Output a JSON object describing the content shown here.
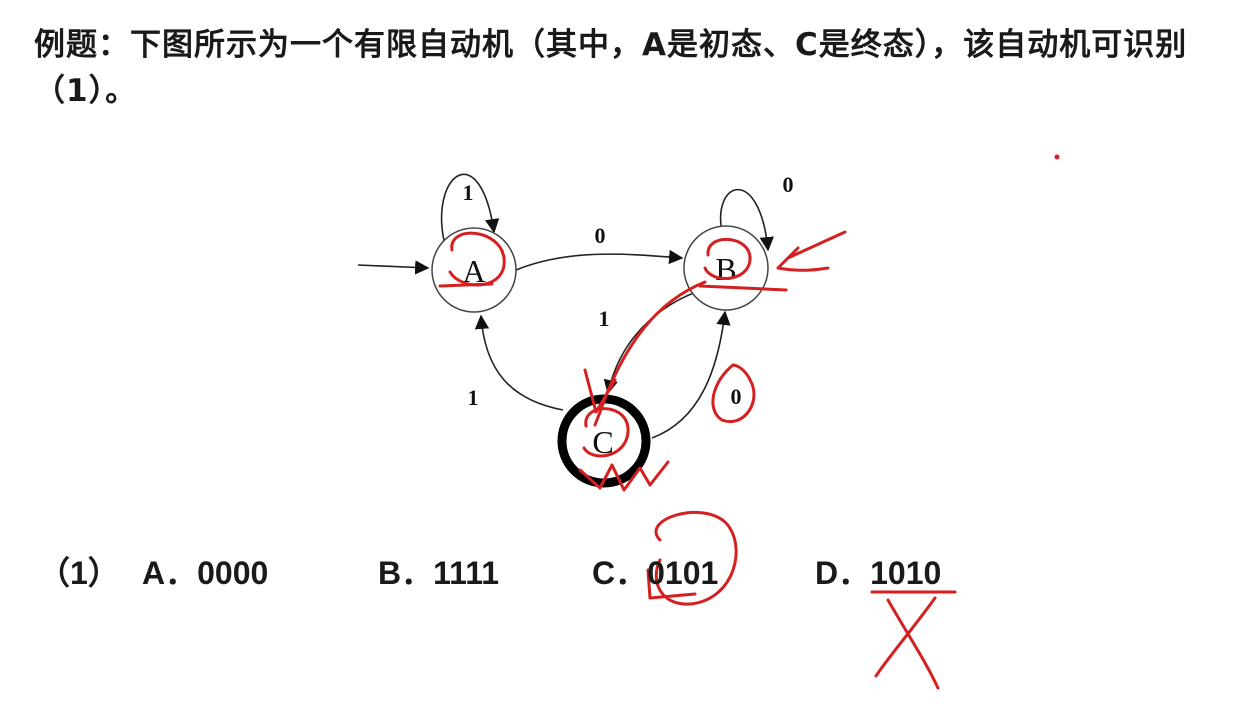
{
  "question": {
    "text": "例题：下图所示为一个有限自动机（其中，A是初态、C是终态），该自动机可识别（1）。"
  },
  "automaton": {
    "states": [
      "A",
      "B",
      "C"
    ],
    "initial_state": "A",
    "final_state": "C",
    "edge_labels": {
      "a_self": "1",
      "a_to_b": "0",
      "b_self": "0",
      "b_to_c": "1",
      "c_to_a": "1",
      "c_to_b": "0"
    }
  },
  "options": {
    "number": "（1）",
    "items": [
      {
        "letter": "A．",
        "value": "0000"
      },
      {
        "letter": "B．",
        "value": "1111"
      },
      {
        "letter": "C．",
        "value": "0101"
      },
      {
        "letter": "D．",
        "value": "1010"
      }
    ]
  },
  "annotation_color": "#d42020"
}
